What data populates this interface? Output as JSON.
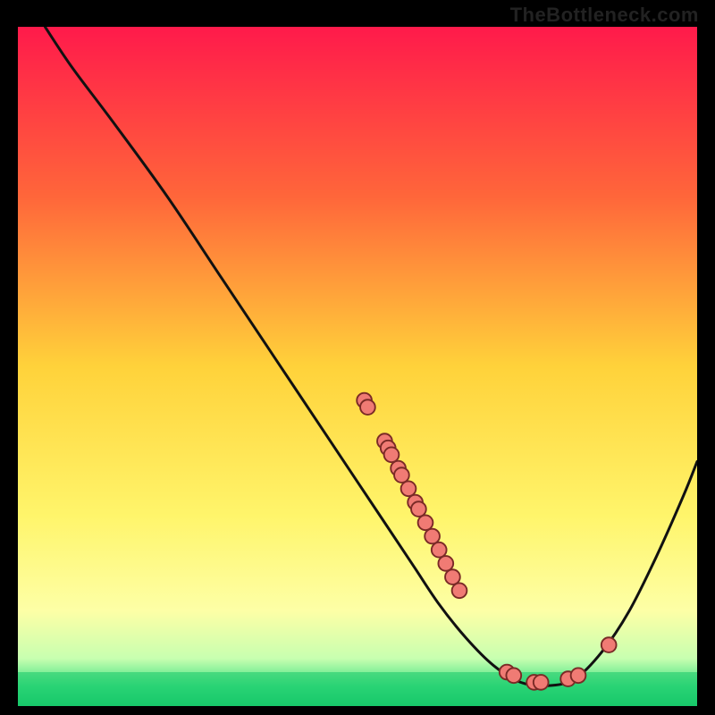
{
  "watermark": "TheBottleneck.com",
  "chart_data": {
    "type": "line",
    "title": "",
    "xlabel": "",
    "ylabel": "",
    "xlim": [
      0,
      100
    ],
    "ylim": [
      0,
      100
    ],
    "gradient_stops": [
      {
        "offset": 0,
        "color": "#ff1a4b"
      },
      {
        "offset": 25,
        "color": "#ff663a"
      },
      {
        "offset": 50,
        "color": "#ffd23a"
      },
      {
        "offset": 72,
        "color": "#fff56b"
      },
      {
        "offset": 86,
        "color": "#fdffa6"
      },
      {
        "offset": 93,
        "color": "#c8ffb0"
      },
      {
        "offset": 97,
        "color": "#41e183"
      },
      {
        "offset": 100,
        "color": "#17c86a"
      }
    ],
    "green_band": {
      "y_from": 95,
      "y_to": 100
    },
    "curve": [
      {
        "x": 4,
        "y": 0
      },
      {
        "x": 8,
        "y": 6
      },
      {
        "x": 14,
        "y": 14
      },
      {
        "x": 22,
        "y": 25
      },
      {
        "x": 30,
        "y": 37
      },
      {
        "x": 38,
        "y": 49
      },
      {
        "x": 46,
        "y": 61
      },
      {
        "x": 52,
        "y": 70
      },
      {
        "x": 58,
        "y": 79
      },
      {
        "x": 62,
        "y": 85
      },
      {
        "x": 66,
        "y": 90
      },
      {
        "x": 70,
        "y": 94
      },
      {
        "x": 74,
        "y": 96.5
      },
      {
        "x": 78,
        "y": 97
      },
      {
        "x": 82,
        "y": 96
      },
      {
        "x": 86,
        "y": 92
      },
      {
        "x": 90,
        "y": 86
      },
      {
        "x": 94,
        "y": 78
      },
      {
        "x": 98,
        "y": 69
      },
      {
        "x": 100,
        "y": 64
      }
    ],
    "markers": [
      {
        "x": 51,
        "y": 55
      },
      {
        "x": 51.5,
        "y": 56
      },
      {
        "x": 54,
        "y": 61
      },
      {
        "x": 54.5,
        "y": 62
      },
      {
        "x": 55,
        "y": 63
      },
      {
        "x": 56,
        "y": 65
      },
      {
        "x": 56.5,
        "y": 66
      },
      {
        "x": 57.5,
        "y": 68
      },
      {
        "x": 58.5,
        "y": 70
      },
      {
        "x": 59,
        "y": 71
      },
      {
        "x": 60,
        "y": 73
      },
      {
        "x": 61,
        "y": 75
      },
      {
        "x": 62,
        "y": 77
      },
      {
        "x": 63,
        "y": 79
      },
      {
        "x": 64,
        "y": 81
      },
      {
        "x": 65,
        "y": 83
      },
      {
        "x": 72,
        "y": 95
      },
      {
        "x": 73,
        "y": 95.5
      },
      {
        "x": 76,
        "y": 96.5
      },
      {
        "x": 77,
        "y": 96.5
      },
      {
        "x": 81,
        "y": 96
      },
      {
        "x": 82.5,
        "y": 95.5
      },
      {
        "x": 87,
        "y": 91
      }
    ],
    "marker_style": {
      "fill": "#f07b74",
      "stroke": "#7a2a26",
      "r": 1.1
    },
    "line_style": {
      "stroke": "#111111",
      "width": 0.45
    }
  }
}
